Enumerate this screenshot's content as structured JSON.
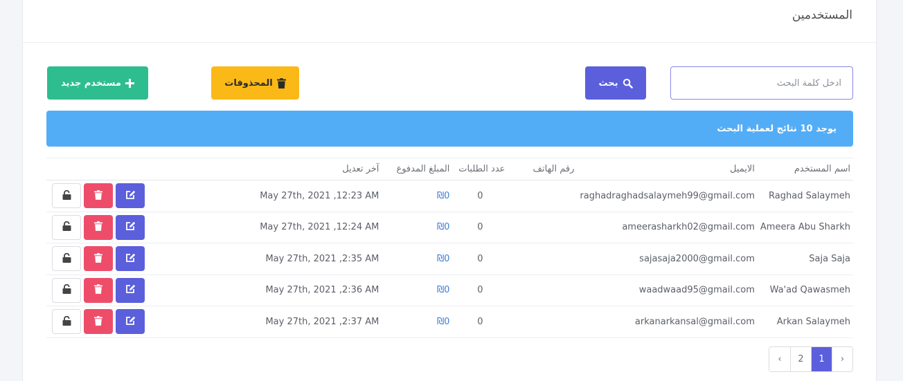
{
  "page": {
    "title": "المستخدمين"
  },
  "search": {
    "placeholder": "ادخل كلمة البحث",
    "button_label": "بحث"
  },
  "toolbar": {
    "deleted_label": "المحذوفات",
    "new_user_label": "مستخدم جديد"
  },
  "alert": {
    "text": "يوجد 10 نتائج لعملية البحث"
  },
  "table": {
    "headers": [
      "اسم المستخدم",
      "الايميل",
      "رقم الهاتف",
      "عدد الطلبات",
      "المبلغ المدفوع",
      "آخر تعديل"
    ],
    "rows": [
      {
        "name": "Raghad Salaymeh",
        "email": "raghadraghadsalaymeh99@gmail.com",
        "phone": "",
        "orders": "0",
        "amount": "₪0",
        "updated": "May 27th, 2021 ,12:23 AM"
      },
      {
        "name": "Ameera Abu Sharkh",
        "email": "ameerasharkh02@gmail.com",
        "phone": "",
        "orders": "0",
        "amount": "₪0",
        "updated": "May 27th, 2021 ,12:24 AM"
      },
      {
        "name": "Saja Saja",
        "email": "sajasaja2000@gmail.com",
        "phone": "",
        "orders": "0",
        "amount": "₪0",
        "updated": "May 27th, 2021 ,2:35 AM"
      },
      {
        "name": "Wa'ad Qawasmeh",
        "email": "waadwaad95@gmail.com",
        "phone": "",
        "orders": "0",
        "amount": "₪0",
        "updated": "May 27th, 2021 ,2:36 AM"
      },
      {
        "name": "Arkan Salaymeh",
        "email": "arkanarkansal@gmail.com",
        "phone": "",
        "orders": "0",
        "amount": "₪0",
        "updated": "May 27th, 2021 ,2:37 AM"
      }
    ]
  },
  "pagination": {
    "prev": "‹",
    "pages": [
      "1",
      "2"
    ],
    "next": "›",
    "active": "1"
  },
  "icons": {
    "search": "search-icon",
    "trash": "trash-icon",
    "plus": "plus-icon",
    "edit": "edit-icon",
    "unlock": "unlock-icon"
  },
  "colors": {
    "primary": "#5b5fdc",
    "warning": "#fbb917",
    "success": "#2ebd8f",
    "info": "#53adf6",
    "danger": "#ee4d6a"
  }
}
